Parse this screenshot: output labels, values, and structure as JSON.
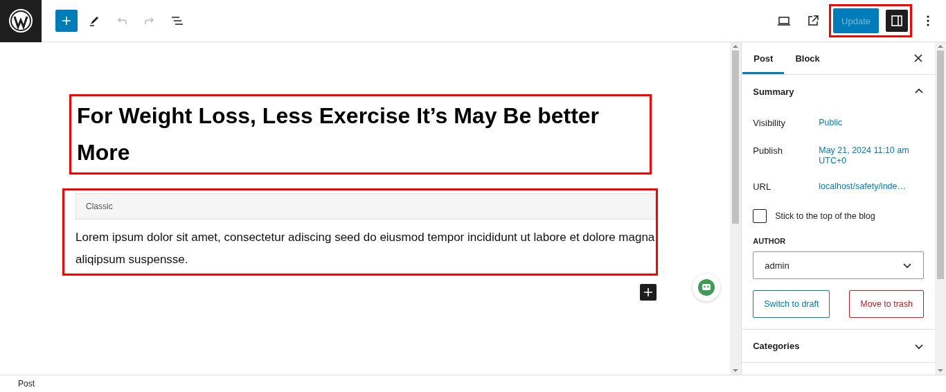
{
  "toolbar": {
    "undo_disabled": true,
    "redo_disabled": true,
    "update": {
      "label": "Update",
      "disabled": true,
      "highlighted": true
    },
    "settings_open": true
  },
  "editor": {
    "title": {
      "text": "For Weight Loss, Less Exercise It’s May Be better More",
      "highlighted": true
    },
    "classic_block": {
      "label": "Classic",
      "text": "Lorem ipsum dolor sit amet, consectetur adiscing seed do eiusmod tempor incididunt ut labore et dolore magna aliqipsum suspensse.",
      "highlighted": true
    }
  },
  "sidebar": {
    "tabs": [
      {
        "label": "Post",
        "selected": true
      },
      {
        "label": "Block",
        "selected": false
      }
    ],
    "panels": [
      {
        "title": "Summary",
        "expanded": true
      },
      {
        "title": "Categories",
        "expanded": false
      }
    ],
    "summary": {
      "rows": [
        {
          "label": "Visibility",
          "value": "Public"
        },
        {
          "label": "Publish",
          "value": "May 21, 2024 11:10 am UTC+0"
        },
        {
          "label": "URL",
          "value": "localhost/safety/inde…"
        }
      ],
      "sticky": {
        "label": "Stick to the top of the blog",
        "checked": false
      },
      "author": {
        "label": "AUTHOR",
        "value": "admin"
      },
      "buttons": [
        {
          "label": "Switch to draft",
          "kind": "secondary"
        },
        {
          "label": "Move to trash",
          "kind": "danger"
        }
      ]
    }
  },
  "status_bar": {
    "breadcrumb": "Post"
  }
}
